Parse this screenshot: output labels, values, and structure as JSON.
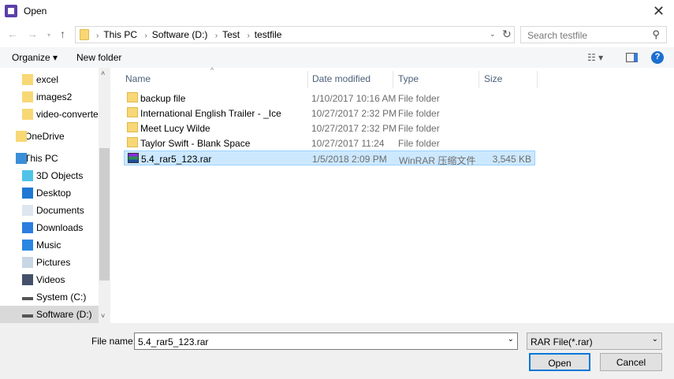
{
  "window": {
    "title": "Open"
  },
  "address": {
    "crumbs": [
      "This PC",
      "Software (D:)",
      "Test",
      "testfile"
    ],
    "search_placeholder": "Search testfile"
  },
  "toolbar": {
    "organize": "Organize ▾",
    "new_folder": "New folder"
  },
  "sidebar": {
    "items": [
      {
        "label": "excel",
        "icon": "folder-icon"
      },
      {
        "label": "images2",
        "icon": "folder-icon"
      },
      {
        "label": "video-converter",
        "icon": "folder-icon"
      },
      {
        "label": "OneDrive",
        "icon": "folder-icon"
      },
      {
        "label": "This PC",
        "icon": "computer-icon"
      },
      {
        "label": "3D Objects",
        "icon": "cube-icon"
      },
      {
        "label": "Desktop",
        "icon": "desktop-icon"
      },
      {
        "label": "Documents",
        "icon": "documents-icon"
      },
      {
        "label": "Downloads",
        "icon": "download-icon"
      },
      {
        "label": "Music",
        "icon": "music-icon"
      },
      {
        "label": "Pictures",
        "icon": "pictures-icon"
      },
      {
        "label": "Videos",
        "icon": "videos-icon"
      },
      {
        "label": "System (C:)",
        "icon": "drive-icon"
      },
      {
        "label": "Software (D:)",
        "icon": "drive-icon"
      }
    ]
  },
  "columns": [
    "Name",
    "Date modified",
    "Type",
    "Size"
  ],
  "files": [
    {
      "name": "backup file",
      "date": "1/10/2017 10:16 AM",
      "type": "File folder",
      "size": ""
    },
    {
      "name": "International English Trailer - _Ice",
      "date": "10/27/2017 2:32 PM",
      "type": "File folder",
      "size": ""
    },
    {
      "name": "Meet Lucy Wilde",
      "date": "10/27/2017 2:32 PM",
      "type": "File folder",
      "size": ""
    },
    {
      "name": "Taylor Swift - Blank Space",
      "date": "10/27/2017 11:24",
      "type": "File folder",
      "size": ""
    },
    {
      "name": "5.4_rar5_123.rar",
      "date": "1/5/2018 2:09 PM",
      "type": "WinRAR 压缩文件",
      "size": "3,545 KB"
    }
  ],
  "footer": {
    "file_name_label": "File name:",
    "file_name": "5.4_rar5_123.rar",
    "filter": "RAR File(*.rar)",
    "open": "Open",
    "cancel": "Cancel"
  }
}
